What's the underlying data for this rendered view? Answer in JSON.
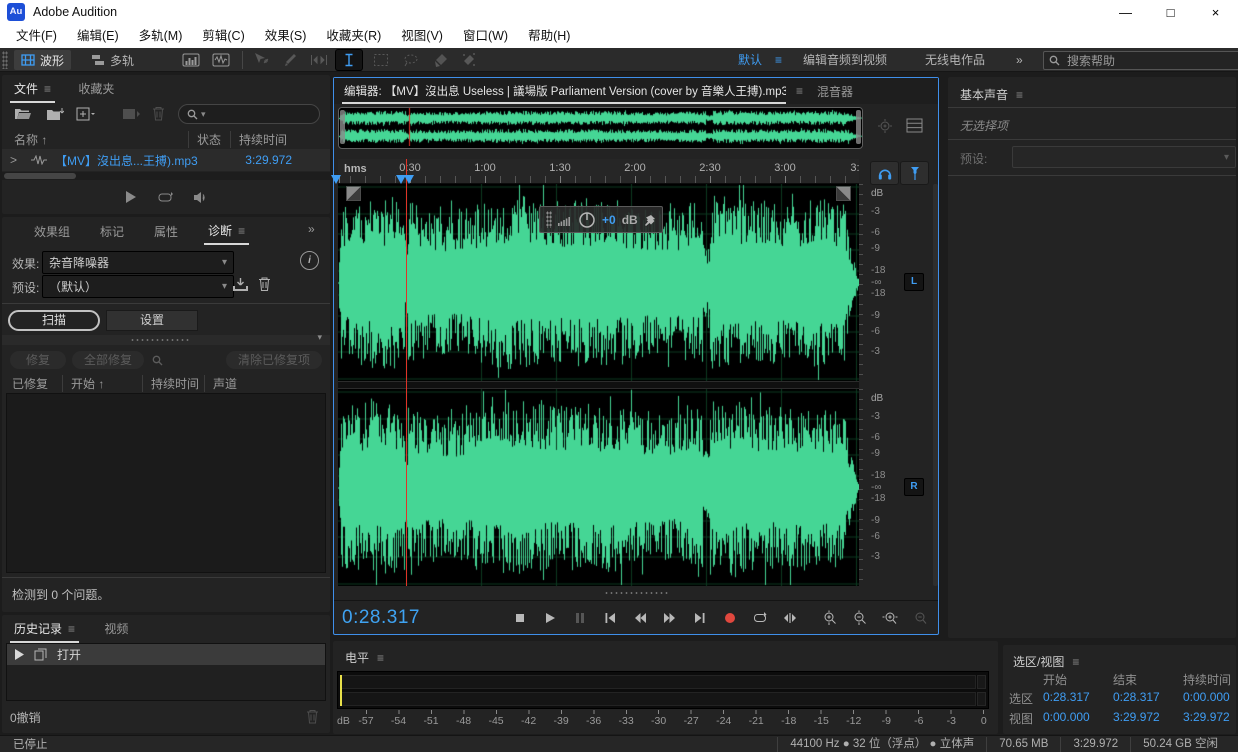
{
  "window": {
    "logo_text": "Au",
    "title": "Adobe Audition"
  },
  "window_controls": {
    "minimize": "—",
    "maximize": "□",
    "close": "×"
  },
  "icons": {
    "menu": "≡",
    "overflow": "»",
    "chevron_down": "▾",
    "sort_asc": "↑",
    "expand": ">",
    "info": "i",
    "play": "▶"
  },
  "menubar": {
    "items": [
      "文件(F)",
      "编辑(E)",
      "多轨(M)",
      "剪辑(C)",
      "效果(S)",
      "收藏夹(R)",
      "视图(V)",
      "窗口(W)",
      "帮助(H)"
    ]
  },
  "toolbar": {
    "waveform": "波形",
    "multitrack": "多轨",
    "workspace": {
      "active": "默认",
      "item1": "编辑音频到视频",
      "item2": "无线电作品"
    },
    "search_placeholder": "搜索帮助"
  },
  "files": {
    "tab_files": "文件",
    "tab_favorites": "收藏夹",
    "col_name": "名称",
    "col_status": "状态",
    "col_duration": "持续时间",
    "rows": [
      {
        "name": "【MV】沒出息...王搏).mp3",
        "duration": "3:29.972"
      }
    ]
  },
  "diagnostics": {
    "tab_effects": "效果组",
    "tab_markers": "标记",
    "tab_props": "属性",
    "tab_diag": "诊断",
    "effect_label": "效果:",
    "effect_value": "杂音降噪器",
    "preset_label": "预设:",
    "preset_value": "（默认）",
    "scan": "扫描",
    "settings": "设置",
    "repair": "修复",
    "repair_all": "全部修复",
    "clear_repaired": "清除已修复项",
    "col_fixed": "已修复",
    "col_start": "开始",
    "col_duration": "持续时间",
    "col_channel": "声道",
    "result_text": "检测到 0 个问题。"
  },
  "history": {
    "tab_history": "历史记录",
    "tab_video": "视频",
    "items": [
      "打开"
    ],
    "undo_text": "0撤销"
  },
  "editor": {
    "tab_editor": "编辑器: 【MV】沒出息 Useless | 議場版 Parliament Version (cover by 音樂人王搏).mp3",
    "tab_mixer": "混音器",
    "ruler_unit": "hms",
    "ruler_ticks": [
      "0:30",
      "1:00",
      "1:30",
      "2:00",
      "2:30",
      "3:00",
      "3:"
    ],
    "hud": {
      "gain": "+0",
      "unit": "dB"
    },
    "db_scale": [
      "dB",
      "-3",
      "-6",
      "-9",
      "-18",
      "-∞",
      "-18",
      "-9",
      "-6",
      "-3"
    ],
    "left_badge": "L",
    "right_badge": "R",
    "time": "0:28.317"
  },
  "essential_sound": {
    "title": "基本声音",
    "empty": "无选择项",
    "preset_label": "预设:"
  },
  "levels": {
    "title": "电平",
    "unit": "dB",
    "scale": [
      "-57",
      "-54",
      "-51",
      "-48",
      "-45",
      "-42",
      "-39",
      "-36",
      "-33",
      "-30",
      "-27",
      "-24",
      "-21",
      "-18",
      "-15",
      "-12",
      "-9",
      "-6",
      "-3",
      "0"
    ]
  },
  "selection_view": {
    "title": "选区/视图",
    "col_start": "开始",
    "col_end": "结束",
    "col_duration": "持续时间",
    "rows": [
      {
        "label": "选区",
        "start": "0:28.317",
        "end": "0:28.317",
        "duration": "0:00.000"
      },
      {
        "label": "视图",
        "start": "0:00.000",
        "end": "3:29.972",
        "duration": "3:29.972"
      }
    ]
  },
  "status": {
    "state": "已停止",
    "items": [
      "44100 Hz ● 32 位（浮点） ● 立体声",
      "70.65 MB",
      "3:29.972",
      "50.24 GB 空闲"
    ]
  },
  "colors": {
    "accent_blue": "#3f9df3",
    "wave_green": "#45d695",
    "playhead_red": "#e03328",
    "record_red": "#e0483e",
    "meter_yellow": "#e8e04a",
    "focus_border": "#3f8fea"
  }
}
